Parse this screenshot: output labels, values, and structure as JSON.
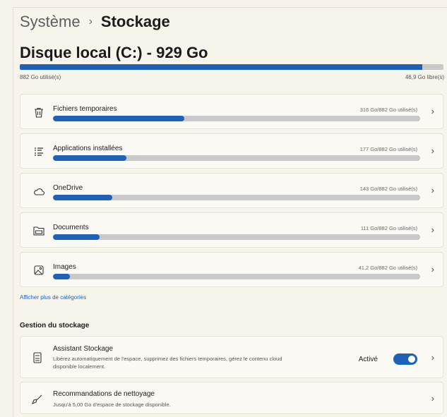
{
  "breadcrumb": {
    "parent": "Système",
    "separator": "›",
    "current": "Stockage"
  },
  "disk": {
    "title": "Disque local (C:) - 929 Go",
    "used_label": "882 Go utilisé(s)",
    "free_label": "46,9 Go libre(s)",
    "used_fraction": 0.95
  },
  "categories": [
    {
      "label": "Fichiers temporaires",
      "usage": "316 Go/882 Go utilisé(s)",
      "fraction": 0.358,
      "icon": "trash-icon"
    },
    {
      "label": "Applications installées",
      "usage": "177 Go/882 Go utilisé(s)",
      "fraction": 0.2,
      "icon": "apps-list-icon"
    },
    {
      "label": "OneDrive",
      "usage": "143 Go/882 Go utilisé(s)",
      "fraction": 0.162,
      "icon": "cloud-icon"
    },
    {
      "label": "Documents",
      "usage": "111 Go/882 Go utilisé(s)",
      "fraction": 0.126,
      "icon": "folder-icon"
    },
    {
      "label": "Images",
      "usage": "41,2 Go/882 Go utilisé(s)",
      "fraction": 0.047,
      "icon": "image-icon"
    }
  ],
  "more_link": "Afficher plus de catégories",
  "management": {
    "title": "Gestion du stockage",
    "assistant": {
      "title": "Assistant Stockage",
      "description_line1": "Libérez automatiquement de l'espace, supprimez des fichiers temporaires, gérez le contenu cloud",
      "description_line2": "disponible localement.",
      "toggle_label": "Activé",
      "toggle_on": true,
      "icon": "storage-drive-icon"
    },
    "cleanup": {
      "title": "Recommandations de nettoyage",
      "description": "Jusqu'à 5,00 Go d'espace de stockage disponible.",
      "icon": "broom-icon"
    }
  },
  "colors": {
    "accent": "#1d62b8",
    "track": "#c9c9c9",
    "background": "#f7f4ec"
  }
}
